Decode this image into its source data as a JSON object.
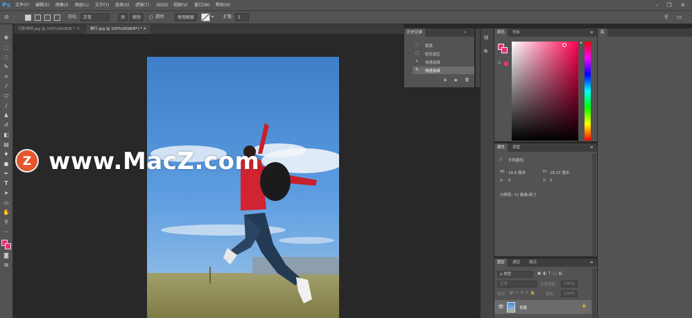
{
  "app": {
    "logo": "Ps",
    "menu": [
      "文件(F)",
      "编辑(E)",
      "图像(I)",
      "图层(L)",
      "文字(Y)",
      "选择(S)",
      "滤镜(T)",
      "3D(D)",
      "视图(V)",
      "窗口(W)",
      "帮助(H)"
    ],
    "window_buttons": [
      "–",
      "❐",
      "✕"
    ]
  },
  "options": {
    "feather_label": "羽化:",
    "mode_value": "正常",
    "add_button": "添",
    "subtract_button": "移除",
    "transparent_label": "透明",
    "bg_label": "使用图案",
    "expand_label": "扩散:",
    "expand_value": "5"
  },
  "tabs": [
    {
      "label": "已影响项.jpg @ 100%(RGB/8) *  ✕"
    },
    {
      "label": "旅行.jpg @ 100%(RGB/8*) *  ✕"
    }
  ],
  "history": {
    "title": "历史记录",
    "items": [
      "套索",
      "矩形选区",
      "快速选择",
      "快速选择"
    ]
  },
  "color_panel": {
    "tabs": [
      "颜色",
      "色板"
    ],
    "accent": "#e8307a"
  },
  "library": {
    "title": "库"
  },
  "properties": {
    "tabs": [
      "属性",
      "调整"
    ],
    "doc_label": "文档属性",
    "w_label": "W:",
    "w_value": "18.8 厘米",
    "h_label": "H:",
    "h_value": "28.22 厘米",
    "x_label": "X:",
    "x_value": "0",
    "y_label": "Y:",
    "y_value": "0",
    "resolution": "分辨率: 72 像素/英寸"
  },
  "layers": {
    "tabs": [
      "图层",
      "通道",
      "路径"
    ],
    "kind": "ρ 类型",
    "mode": "正常",
    "opacity": "不透明度:",
    "opacity_value": "100%",
    "lock": "锁定:",
    "fill": "填充:",
    "fill_value": "100%",
    "layer_name": "背景"
  },
  "watermark": {
    "letter": "Z",
    "text": "www.MacZ.com"
  }
}
